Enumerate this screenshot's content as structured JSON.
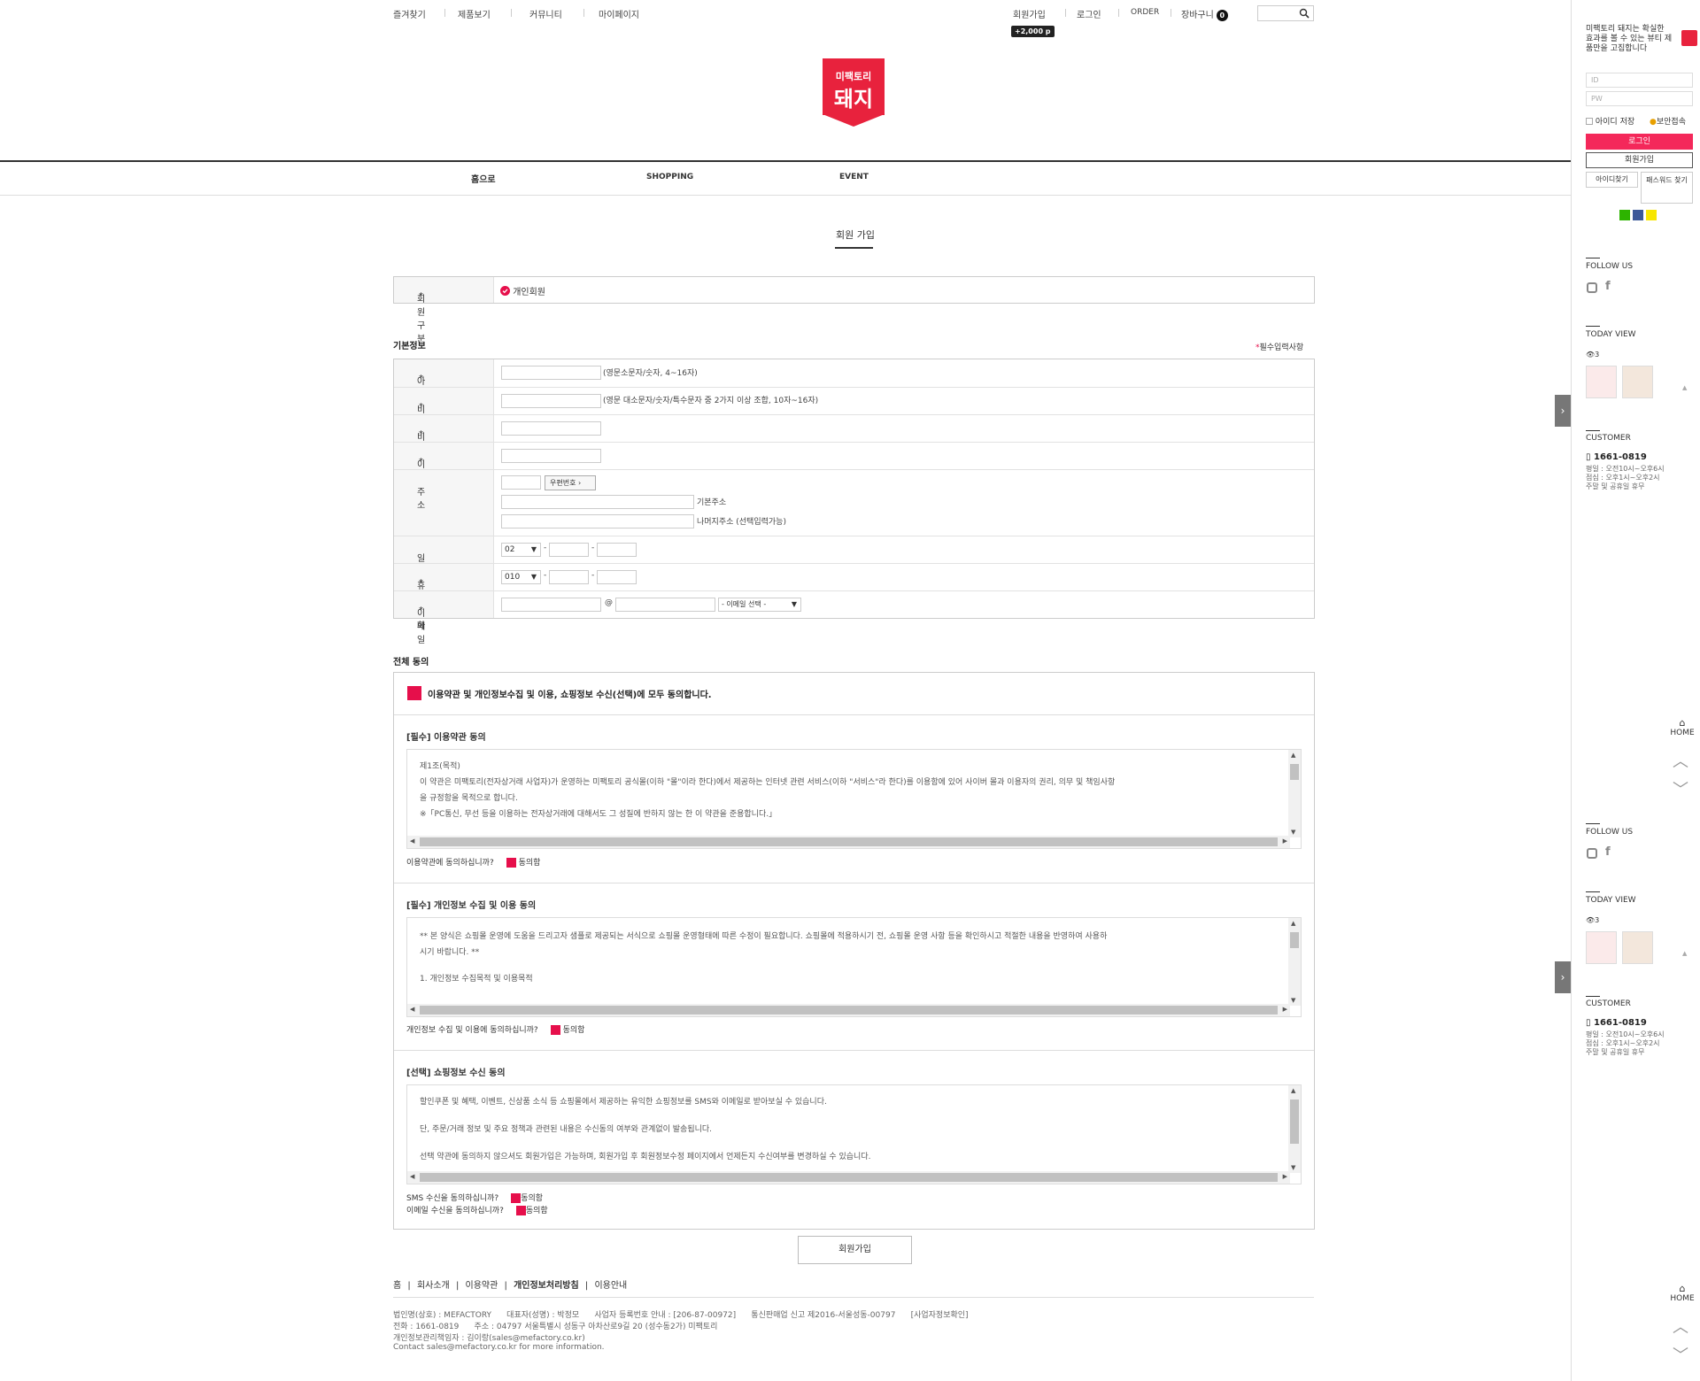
{
  "topbar": {
    "left_links": [
      "즐겨찾기",
      "제품보기",
      "커뮤니티",
      "마이페이지"
    ],
    "right_links": {
      "join": "회원가입",
      "login": "로그인",
      "order": "ORDER",
      "cart": "장바구니"
    },
    "cart_count": "0",
    "point_badge": "+2,000 p"
  },
  "logo": {
    "line1": "미팩토리",
    "line2": "돼지",
    "color": "#e8223d"
  },
  "nav": {
    "items": [
      "홈으로",
      "SHOPPING",
      "EVENT"
    ]
  },
  "page_title": "회원 가입",
  "member_type": {
    "label": "회원구분",
    "value": "개인회원"
  },
  "basic_info": {
    "title": "기본정보",
    "required_note": "필수입력사항",
    "fields": {
      "id": {
        "label": "아이디",
        "hint": "(영문소문자/숫자, 4~16자)"
      },
      "password": {
        "label": "비밀번호",
        "hint": "(영문 대소문자/숫자/특수문자 중 2가지 이상 조합, 10자~16자)"
      },
      "password_confirm": {
        "label": "비밀번호 확인"
      },
      "name": {
        "label": "이름"
      },
      "address": {
        "label": "주소",
        "zip_button": "우편번호",
        "base_label": "기본주소",
        "rest_label": "나머지주소 (선택입력가능)"
      },
      "phone": {
        "label": "일반전화",
        "prefix": "02"
      },
      "mobile": {
        "label": "휴대전화",
        "prefix": "010"
      },
      "email": {
        "label": "이메일",
        "at": "@",
        "domain_select": "- 이메일 선택 -"
      }
    }
  },
  "agreement": {
    "section_title": "전체 동의",
    "all_agree": "이용약관 및 개인정보수집 및 이용, 쇼핑정보 수신(선택)에 모두 동의합니다.",
    "terms": {
      "title": "[필수] 이용약관 동의",
      "lines": [
        "제1조(목적)",
        "이 약관은 미팩토리(전자상거래 사업자)가 운영하는 미팩토리 공식몰(이하 \"몰\"이라 한다)에서 제공하는 인터넷 관련 서비스(이하 \"서비스\"라 한다)를 이용함에 있어 사이버 몰과 이용자의 권리, 의무 및 책임사항",
        "을 규정함을 목적으로 합니다.",
        "※「PC통신, 무선 등을 이용하는 전자상거래에 대해서도 그 성질에 반하지 않는 한 이 약관을 준용합니다.」"
      ],
      "question": "이용약관에 동의하십니까?",
      "agree": "동의함"
    },
    "privacy": {
      "title": "[필수] 개인정보 수집 및 이용 동의",
      "lines": [
        " ** 본 양식은 쇼핑몰 운영에 도움을 드리고자 샘플로 제공되는 서식으로 쇼핑몰 운영형태에 따른 수정이 필요합니다. 쇼핑몰에 적용하시기 전, 쇼핑몰 운영 사항 등을 확인하시고 적절한 내용을 반영하여 사용하",
        "시기 바랍니다. **",
        "",
        "1. 개인정보 수집목적 및 이용목적"
      ],
      "question": "개인정보 수집 및 이용에 동의하십니까?",
      "agree": "동의함"
    },
    "marketing": {
      "title": "[선택] 쇼핑정보 수신 동의",
      "lines": [
        "할인쿠폰 및 혜택, 이벤트, 신상품 소식 등 쇼핑몰에서 제공하는 유익한 쇼핑정보를 SMS와 이메일로 받아보실 수 있습니다.",
        "",
        "단, 주문/거래 정보 및 주요 정책과 관련된 내용은 수신동의 여부와 관계없이 발송됩니다.",
        "",
        "선택 약관에 동의하지 않으셔도 회원가입은 가능하며, 회원가입 후 회원정보수정 페이지에서 언제든지 수신여부를 변경하실 수 있습니다."
      ],
      "sms_question": "SMS 수신을 동의하십니까?",
      "email_question": "이메일 수신을 동의하십니까?",
      "agree": "동의함"
    },
    "accent_color": "#e60f4b"
  },
  "join_button": "회원가입",
  "footer": {
    "links": [
      "홈",
      "회사소개",
      "이용약관",
      "개인정보처리방침",
      "이용안내"
    ],
    "line1": "법인명(상호) : MEFACTORY      대표자(성명) : 박정모      사업자 등록번호 안내 : [206-87-00972]      통신판매업 신고 제2016-서울성동-00797      [사업자정보확인]",
    "line2": "전화 : 1661-0819      주소 : 04797 서울특별시 성동구 아차산로9길 20 (성수동2가) 미팩토리",
    "line3": "개인정보관리책임자 : 김이랑(sales@mefactory.co.kr)",
    "line4": "Contact sales@mefactory.co.kr for more information."
  },
  "right_panel": {
    "intro": "미팩토리 돼지는 확실한 효과를 볼 수 있는 뷰티 제품만을 고집합니다",
    "id_placeholder": "ID",
    "pw_placeholder": "PW",
    "save_id": "아이디 저장",
    "secure": "보안접속",
    "login": "로그인",
    "join": "회원가입",
    "find_id": "아이디찾기",
    "find_pw": "패스워드 찾기",
    "follow_us": "FOLLOW US",
    "today_view": "TODAY VIEW",
    "view_count": "3",
    "customer": "CUSTOMER",
    "phone": "1661-0819",
    "hours": [
      "평일 : 오전10시~오후6시",
      "점심 : 오후1시~오후2시",
      "주말 및 공휴일 휴무"
    ],
    "home": "HOME"
  }
}
